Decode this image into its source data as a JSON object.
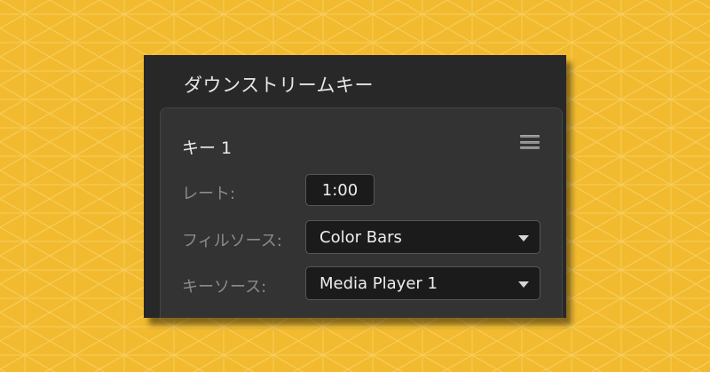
{
  "colors": {
    "background": "#f2bb2f",
    "pattern_line": "#f8d56e",
    "panel": "#282828",
    "card": "#333333",
    "field": "#1b1b1b"
  },
  "panel": {
    "title": "ダウンストリームキー"
  },
  "key_card": {
    "title": "キー 1",
    "menu_icon": "hamburger-menu-icon",
    "rate": {
      "label": "レート:",
      "value": "1:00"
    },
    "fill_source": {
      "label": "フィルソース:",
      "value": "Color Bars",
      "icon": "chevron-down-icon"
    },
    "key_source": {
      "label": "キーソース:",
      "value": "Media Player 1",
      "icon": "chevron-down-icon"
    }
  }
}
